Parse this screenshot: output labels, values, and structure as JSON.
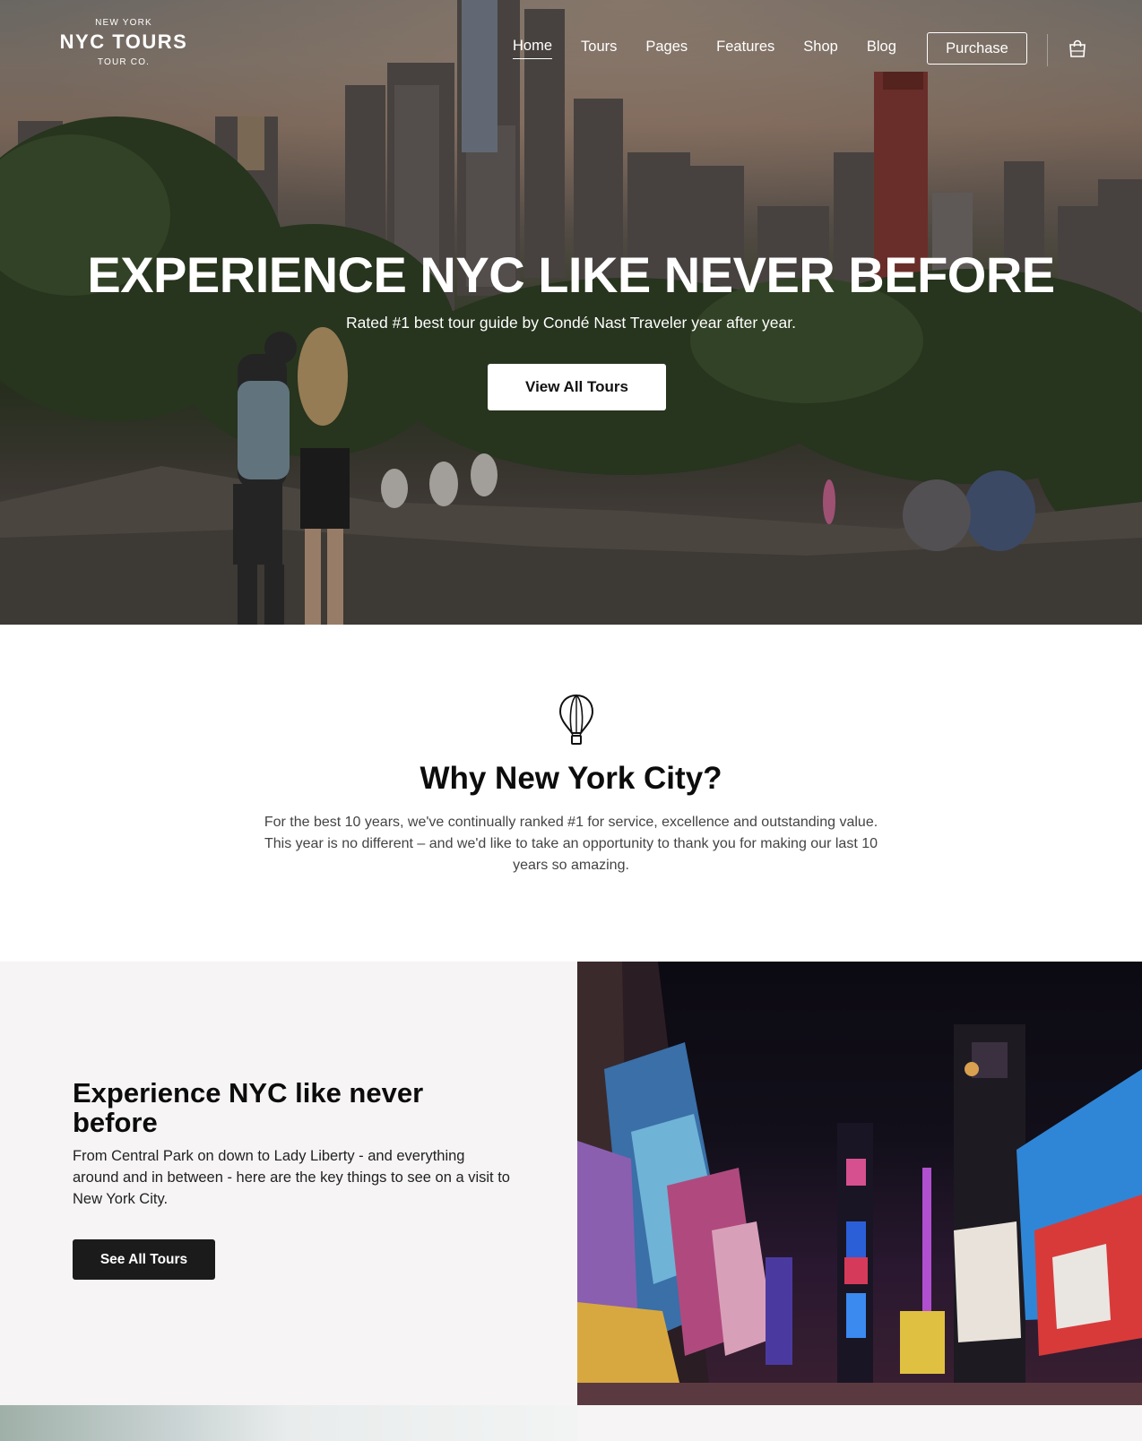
{
  "brand": {
    "top": "NEW YORK",
    "main": "NYC TOURS",
    "bottom": "TOUR CO."
  },
  "nav": {
    "items": [
      {
        "label": "Home",
        "active": true
      },
      {
        "label": "Tours"
      },
      {
        "label": "Pages"
      },
      {
        "label": "Features"
      },
      {
        "label": "Shop"
      },
      {
        "label": "Blog"
      }
    ],
    "purchase_label": "Purchase",
    "cart_icon": "shopping-bag-icon"
  },
  "hero": {
    "title": "EXPERIENCE NYC LIKE NEVER BEFORE",
    "subtitle": "Rated #1 best tour guide by Condé Nast Traveler year after year.",
    "button_label": "View All Tours"
  },
  "why": {
    "icon": "hot-air-balloon-icon",
    "title": "Why New York City?",
    "text": "For the best 10 years, we've continually ranked #1 for service, excellence and outstanding value. This year is no different – and we'd like to take an opportunity to thank you for making our last 10 years so amazing."
  },
  "feature": {
    "title": "Experience NYC like never before",
    "text": "From Central Park on down to Lady Liberty - and everything around and in between - here are the key things to see on a visit to New York City.",
    "button_label": "See All Tours"
  },
  "colors": {
    "accent_dark": "#1b1b1b",
    "section_bg": "#f6f4f5",
    "text_light": "#ffffff"
  }
}
